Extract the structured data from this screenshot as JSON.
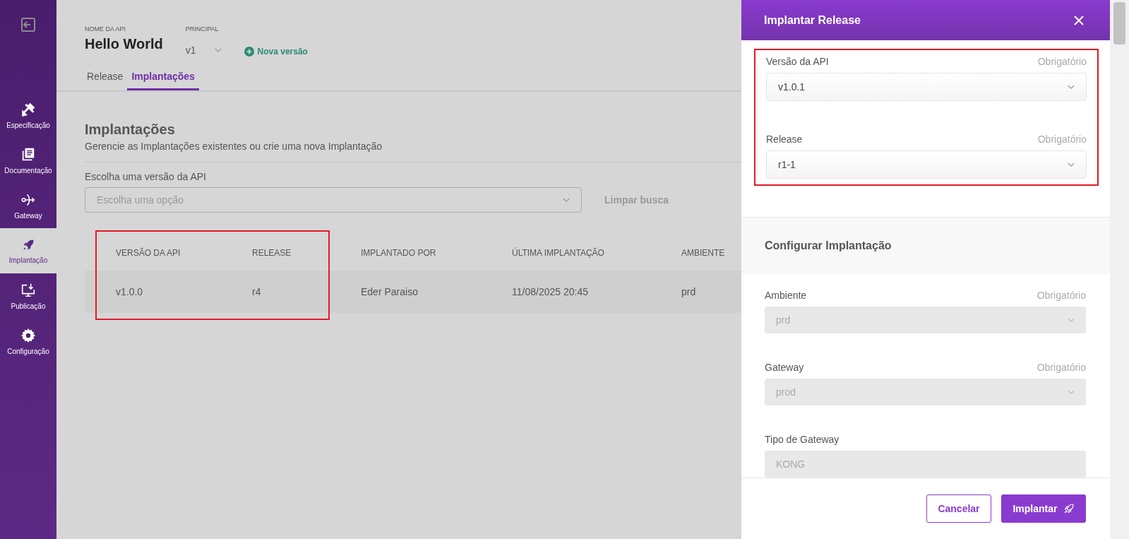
{
  "sidebar": {
    "items": [
      {
        "label": "Especificação",
        "selected": false
      },
      {
        "label": "Documentação",
        "selected": false
      },
      {
        "label": "Gateway",
        "selected": false
      },
      {
        "label": "Implantação",
        "selected": true
      },
      {
        "label": "Publicação",
        "selected": false
      },
      {
        "label": "Configuração",
        "selected": false
      }
    ]
  },
  "header": {
    "api_name_label": "NOME DA API",
    "api_name": "Hello World",
    "principal_label": "PRINCIPAL",
    "principal_value": "v1",
    "new_version": "Nova versão"
  },
  "tabs": [
    {
      "label": "Release",
      "selected": false
    },
    {
      "label": "Implantações",
      "selected": true
    }
  ],
  "content": {
    "title": "Implantações",
    "subtitle": "Gerencie as Implantações existentes ou crie uma nova Implantação",
    "filter_label": "Escolha uma versão da API",
    "filter": {
      "placeholder": "Escolha uma opção"
    },
    "clear": "Limpar busca"
  },
  "table": {
    "highlighted": true,
    "columns": [
      {
        "label": "VERSÃO DA API"
      },
      {
        "label": "RELEASE"
      },
      {
        "label": "IMPLANTADO POR"
      },
      {
        "label": "ÚLTIMA IMPLANTAÇÃO"
      },
      {
        "label": "AMBIENTE"
      }
    ],
    "rows": [
      [
        "v1.0.0",
        "r4",
        "Eder Paraiso",
        "11/08/2025 20:45",
        "prd"
      ]
    ]
  },
  "drawer": {
    "title": "Implantar Release",
    "release_section": {
      "highlighted": true,
      "fields": [
        {
          "label": "Versão da API",
          "required": "Obrigatório",
          "value": "v1.0.1",
          "kind": "select",
          "disabled": false
        },
        {
          "label": "Release",
          "required": "Obrigatório",
          "value": "r1-1",
          "kind": "select",
          "disabled": false
        }
      ]
    },
    "config_title": "Configurar Implantação",
    "config_fields": [
      {
        "label": "Ambiente",
        "required": "Obrigatório",
        "value": "prd",
        "kind": "select",
        "disabled": true
      },
      {
        "label": "Gateway",
        "required": "Obrigatório",
        "value": "prod",
        "kind": "select",
        "disabled": true
      },
      {
        "label": "Tipo de Gateway",
        "value": "KONG",
        "kind": "text",
        "disabled": true
      }
    ],
    "cancel": "Cancelar",
    "submit": "Implantar"
  }
}
